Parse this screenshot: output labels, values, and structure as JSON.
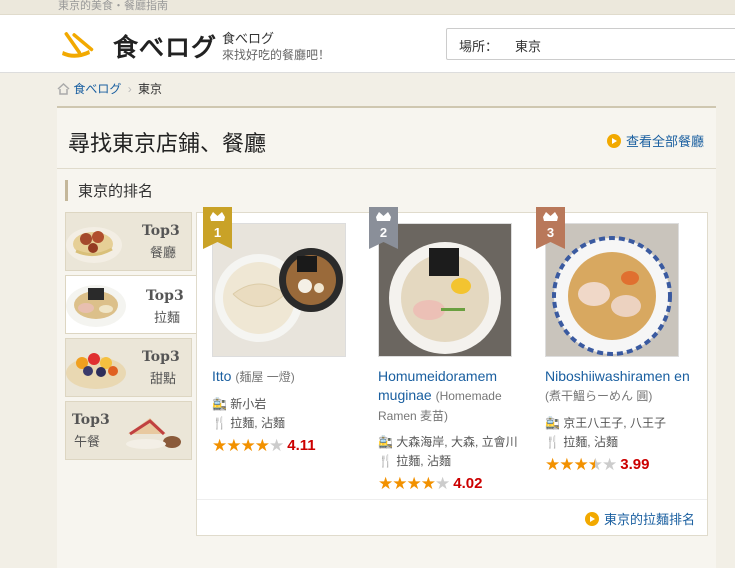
{
  "top_strip": {
    "text": "東京的美食・餐廳指南"
  },
  "header": {
    "logo_text": "食べログ",
    "brand_name": "食べログ",
    "slogan": "來找好吃的餐廳吧！",
    "location_label": "場所：",
    "location_value": "東京"
  },
  "breadcrumb": {
    "home": "食べログ",
    "current": "東京"
  },
  "main": {
    "title": "尋找東京店鋪、餐廳",
    "all_link": "查看全部餐廳",
    "ranking_heading": "東京的排名",
    "more_link": "東京的拉麵排名"
  },
  "tabs": [
    {
      "top": "Top3",
      "label": "餐廳"
    },
    {
      "top": "Top3",
      "label": "拉麵"
    },
    {
      "top": "Top3",
      "label": "甜點"
    },
    {
      "top": "Top3",
      "label": "午餐"
    }
  ],
  "active_tab": 1,
  "restaurants": [
    {
      "rank": "1",
      "name": "Itto",
      "sub": "(麺屋 一燈)",
      "station": "新小岩",
      "genre": "拉麵, 沾麵",
      "rating": 4.11,
      "rating_text": "4.11",
      "stars": 4
    },
    {
      "rank": "2",
      "name": "Homumeidoramem muginae",
      "sub": "(Homemade Ramen 麦苗)",
      "station": "大森海岸, 大森, 立會川",
      "genre": "拉麵, 沾麵",
      "rating": 4.02,
      "rating_text": "4.02",
      "stars": 4
    },
    {
      "rank": "3",
      "name": "Niboshiiwashiramen en",
      "sub": "(煮干鰮らーめん 圓)",
      "station": "京王八王子, 八王子",
      "genre": "拉麵, 沾麵",
      "rating": 3.99,
      "rating_text": "3.99",
      "stars": 3.5
    }
  ],
  "colors": {
    "link": "#1a5fa0",
    "star": "#f29100",
    "score": "#cc0000",
    "gold": "#c9a227",
    "silver": "#8a8f99",
    "bronze": "#b9785a"
  }
}
